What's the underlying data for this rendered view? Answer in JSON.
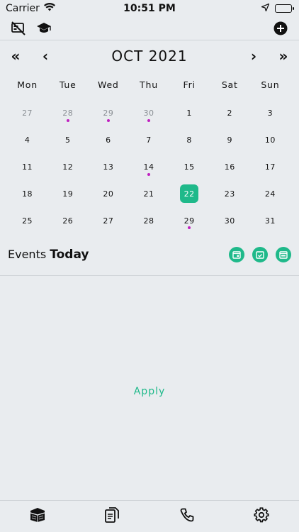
{
  "status_bar": {
    "carrier": "Carrier",
    "time": "10:51 PM"
  },
  "icons": {
    "top_left_1": "crossed-card-icon",
    "top_left_2": "graduation-cap-icon",
    "top_right": "add-circle-icon",
    "tabs": [
      "kaaba-icon",
      "document-icon",
      "phone-icon",
      "gear-icon"
    ]
  },
  "calendar": {
    "month_title": "OCT 2021",
    "prev_year": "«",
    "prev_month": "‹",
    "next_month": "›",
    "next_year": "»",
    "weekdays": [
      "Mon",
      "Tue",
      "Wed",
      "Thu",
      "Fri",
      "Sat",
      "Sun"
    ],
    "days": [
      {
        "n": "27",
        "muted": true,
        "dot": false
      },
      {
        "n": "28",
        "muted": true,
        "dot": true
      },
      {
        "n": "29",
        "muted": true,
        "dot": true
      },
      {
        "n": "30",
        "muted": true,
        "dot": true
      },
      {
        "n": "1",
        "muted": false,
        "dot": false
      },
      {
        "n": "2",
        "muted": false,
        "dot": false
      },
      {
        "n": "3",
        "muted": false,
        "dot": false
      },
      {
        "n": "4",
        "muted": false,
        "dot": false
      },
      {
        "n": "5",
        "muted": false,
        "dot": false
      },
      {
        "n": "6",
        "muted": false,
        "dot": false
      },
      {
        "n": "7",
        "muted": false,
        "dot": false
      },
      {
        "n": "8",
        "muted": false,
        "dot": false
      },
      {
        "n": "9",
        "muted": false,
        "dot": false
      },
      {
        "n": "10",
        "muted": false,
        "dot": false
      },
      {
        "n": "11",
        "muted": false,
        "dot": false
      },
      {
        "n": "12",
        "muted": false,
        "dot": false
      },
      {
        "n": "13",
        "muted": false,
        "dot": false
      },
      {
        "n": "14",
        "muted": false,
        "dot": true
      },
      {
        "n": "15",
        "muted": false,
        "dot": false
      },
      {
        "n": "16",
        "muted": false,
        "dot": false
      },
      {
        "n": "17",
        "muted": false,
        "dot": false
      },
      {
        "n": "18",
        "muted": false,
        "dot": false
      },
      {
        "n": "19",
        "muted": false,
        "dot": false
      },
      {
        "n": "20",
        "muted": false,
        "dot": false
      },
      {
        "n": "21",
        "muted": false,
        "dot": false
      },
      {
        "n": "22",
        "muted": false,
        "dot": false,
        "selected": true
      },
      {
        "n": "23",
        "muted": false,
        "dot": false
      },
      {
        "n": "24",
        "muted": false,
        "dot": false
      },
      {
        "n": "25",
        "muted": false,
        "dot": false
      },
      {
        "n": "26",
        "muted": false,
        "dot": false
      },
      {
        "n": "27",
        "muted": false,
        "dot": false
      },
      {
        "n": "28",
        "muted": false,
        "dot": false
      },
      {
        "n": "29",
        "muted": false,
        "dot": true
      },
      {
        "n": "30",
        "muted": false,
        "dot": false
      },
      {
        "n": "31",
        "muted": false,
        "dot": false
      }
    ]
  },
  "events": {
    "label": "Events",
    "label_bold": "Today",
    "icons": [
      "calendar-today-icon",
      "calendar-check-icon",
      "calendar-range-icon"
    ]
  },
  "apply_label": "Apply",
  "colors": {
    "accent": "#1fb98a",
    "event_dot": "#c020c0",
    "background": "#e9ecef"
  }
}
